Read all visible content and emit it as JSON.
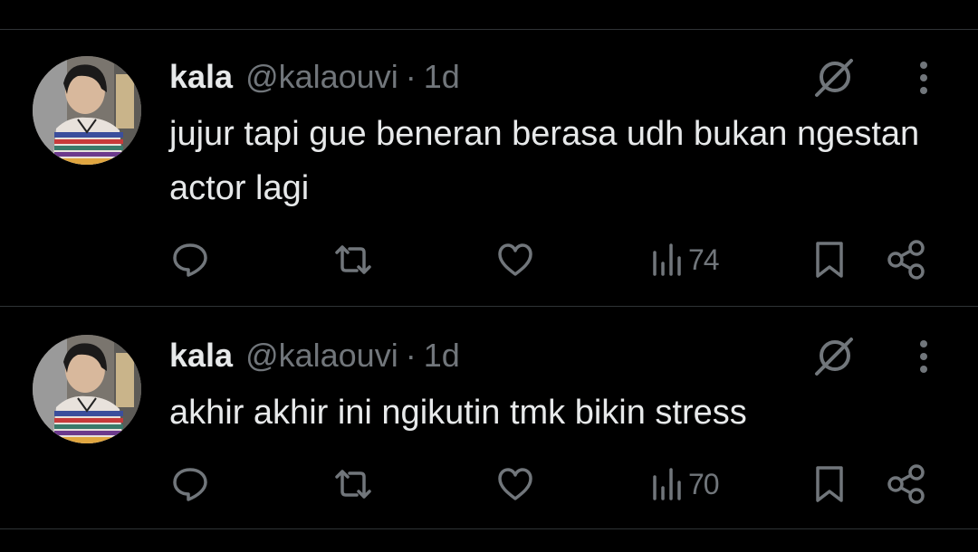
{
  "colors": {
    "background": "#000000",
    "text_primary": "#e7e9ea",
    "text_secondary": "#71767b",
    "divider": "#2f3336"
  },
  "tweets": [
    {
      "author_name": "kala",
      "handle": "@kalaouvi",
      "separator": "·",
      "time": "1d",
      "text": "jujur tapi gue beneran berasa udh bukan ngestan actor lagi",
      "views": "74",
      "icons": [
        "grok-icon",
        "more-icon",
        "reply-icon",
        "retweet-icon",
        "like-icon",
        "views-icon",
        "bookmark-icon",
        "share-icon"
      ]
    },
    {
      "author_name": "kala",
      "handle": "@kalaouvi",
      "separator": "·",
      "time": "1d",
      "text": "akhir akhir ini ngikutin tmk bikin stress",
      "views": "70",
      "icons": [
        "grok-icon",
        "more-icon",
        "reply-icon",
        "retweet-icon",
        "like-icon",
        "views-icon",
        "bookmark-icon",
        "share-icon"
      ]
    }
  ]
}
